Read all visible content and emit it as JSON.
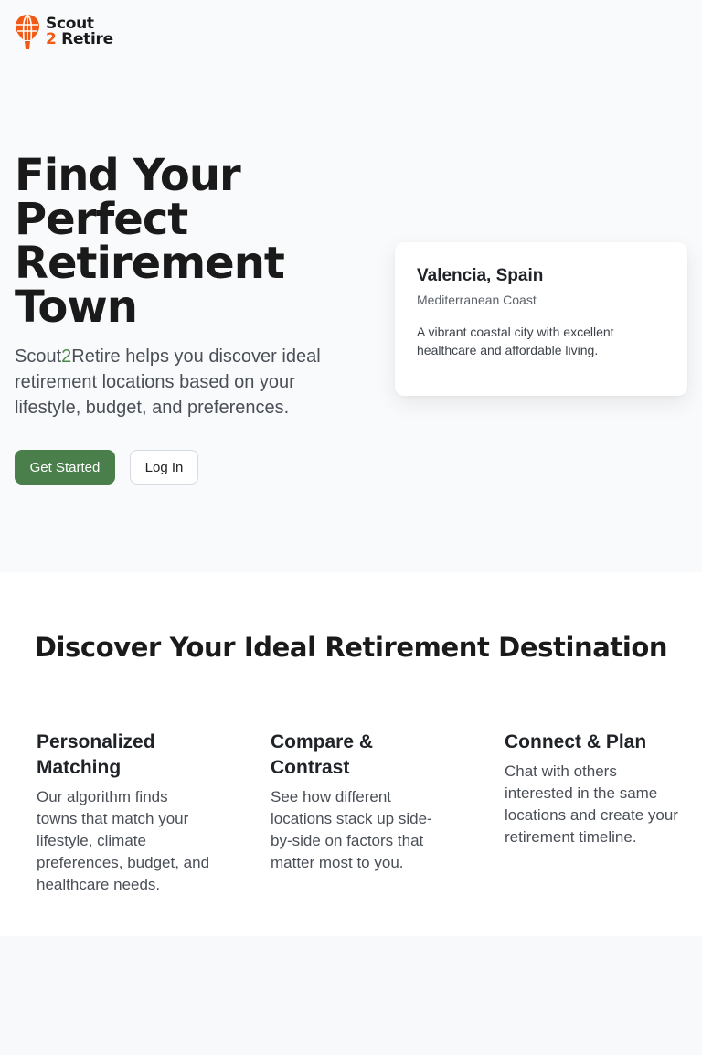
{
  "brand": {
    "name_line1": "Scout",
    "name_line2_number": "2",
    "name_line2_word": "Retire",
    "accent_color": "#f05a16",
    "icon": "hot-air-balloon-icon"
  },
  "hero": {
    "title": "Find Your Perfect Retirement Town",
    "subtitle_prefix": "Scout",
    "subtitle_number": "2",
    "subtitle_rest": "Retire helps you discover ideal retirement locations based on your lifestyle, budget, and preferences.",
    "primary_button": "Get Started",
    "secondary_button": "Log In",
    "primary_color": "#4a7f4c"
  },
  "featured_card": {
    "title": "Valencia, Spain",
    "region": "Mediterranean Coast",
    "description": "A vibrant coastal city with excellent healthcare and affordable living."
  },
  "features": {
    "title": "Discover Your Ideal Retirement Destination",
    "items": [
      {
        "title": "Personalized Matching",
        "description": "Our algorithm finds towns that match your lifestyle, climate preferences, budget, and healthcare needs."
      },
      {
        "title": "Compare & Contrast",
        "description": "See how different locations stack up side-by-side on factors that matter most to you."
      },
      {
        "title": "Connect & Plan",
        "description": "Chat with others interested in the same locations and create your retirement timeline."
      }
    ]
  }
}
